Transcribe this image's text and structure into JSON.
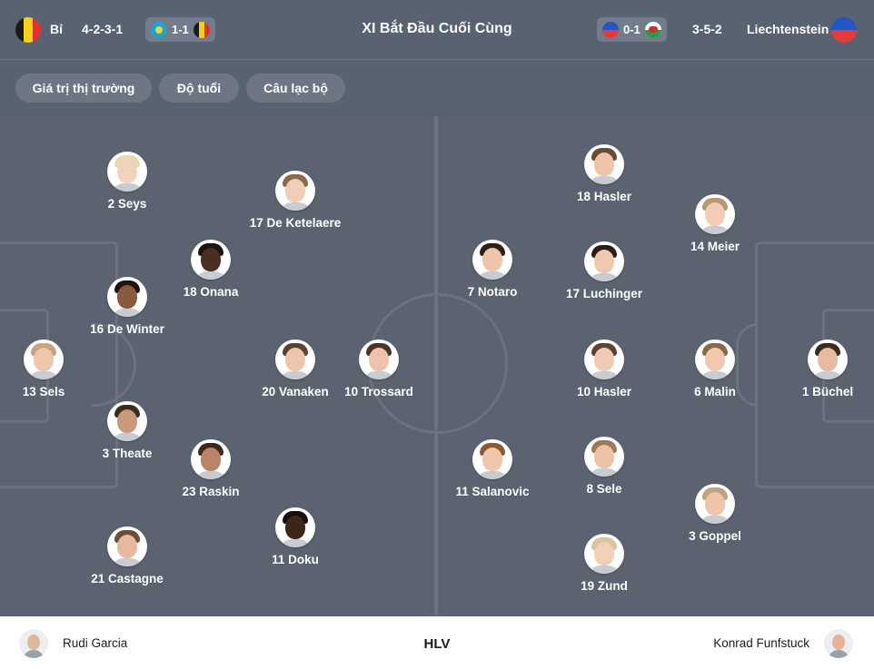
{
  "header": {
    "title": "XI Bắt Đầu Cuối Cùng",
    "home": {
      "name": "Bỉ",
      "formation": "4-2-3-1",
      "last_score": "1-1"
    },
    "away": {
      "name": "Liechtenstein",
      "formation": "3-5-2",
      "last_score": "0-1"
    }
  },
  "filters": [
    "Giá trị thị trường",
    "Độ tuổi",
    "Câu lạc bộ"
  ],
  "home_players": [
    {
      "label": "2 Seys"
    },
    {
      "label": "17 De Ketelaere"
    },
    {
      "label": "18 Onana"
    },
    {
      "label": "16 De Winter"
    },
    {
      "label": "13 Sels"
    },
    {
      "label": "20 Vanaken"
    },
    {
      "label": "10 Trossard"
    },
    {
      "label": "3 Theate"
    },
    {
      "label": "23 Raskin"
    },
    {
      "label": "21 Castagne"
    },
    {
      "label": "11 Doku"
    }
  ],
  "away_players": [
    {
      "label": "18 Hasler"
    },
    {
      "label": "14 Meier"
    },
    {
      "label": "7 Notaro"
    },
    {
      "label": "17 Luchinger"
    },
    {
      "label": "10 Hasler"
    },
    {
      "label": "6 Malin"
    },
    {
      "label": "1 Büchel"
    },
    {
      "label": "11 Salanovic"
    },
    {
      "label": "8 Sele"
    },
    {
      "label": "3 Goppel"
    },
    {
      "label": "19 Zund"
    }
  ],
  "coaches": {
    "label": "HLV",
    "home": "Rudi Garcia",
    "away": "Konrad Funfstuck"
  },
  "colors": {
    "pitch": "#5b6370",
    "header": "#596270",
    "belgium_black": "#1a1a1a",
    "belgium_yellow": "#f6cf1d",
    "belgium_red": "#e2322f",
    "liechtenstein_blue": "#2556c6",
    "liechtenstein_red": "#e33b3b"
  }
}
